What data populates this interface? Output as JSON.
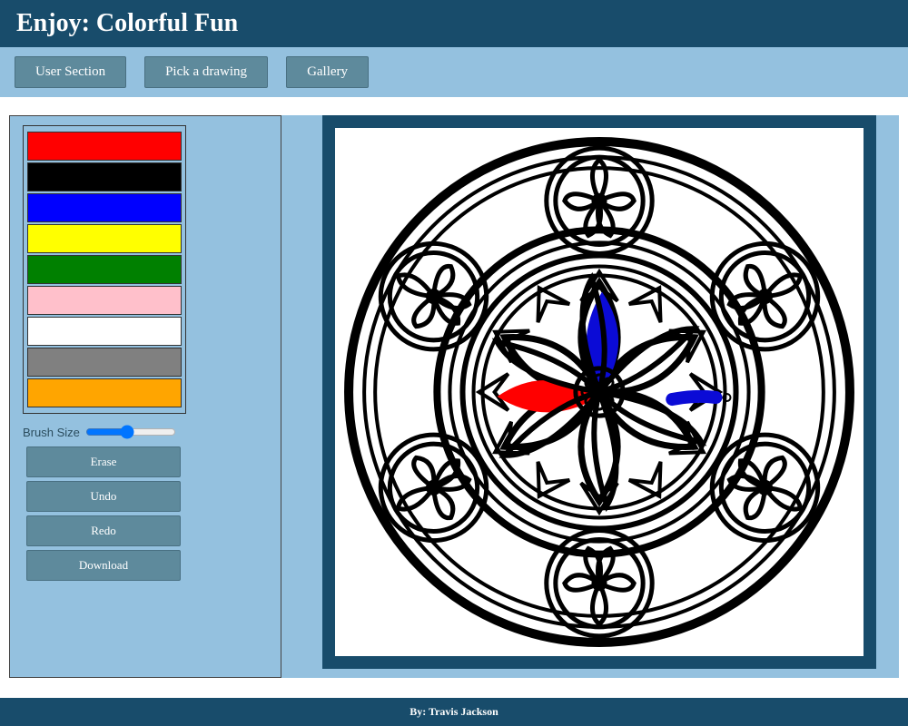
{
  "header": {
    "title": "Enjoy: Colorful Fun"
  },
  "nav": {
    "user_section": "User Section",
    "pick_drawing": "Pick a drawing",
    "gallery": "Gallery"
  },
  "palette": {
    "colors": [
      "#ff0000",
      "#000000",
      "#0000ff",
      "#ffff00",
      "#008000",
      "#ffc0cb",
      "#ffffff",
      "#808080",
      "#ffa500"
    ]
  },
  "tools": {
    "brush_label": "Brush Size",
    "brush_value": 45,
    "erase": "Erase",
    "undo": "Undo",
    "redo": "Redo",
    "download": "Download"
  },
  "canvas": {
    "painted": {
      "petal_top_color": "#0b0bd6",
      "petal_left_color": "#ff0000",
      "stroke_right_color": "#0b0bd6"
    }
  },
  "footer": {
    "credit": "By: Travis Jackson"
  }
}
